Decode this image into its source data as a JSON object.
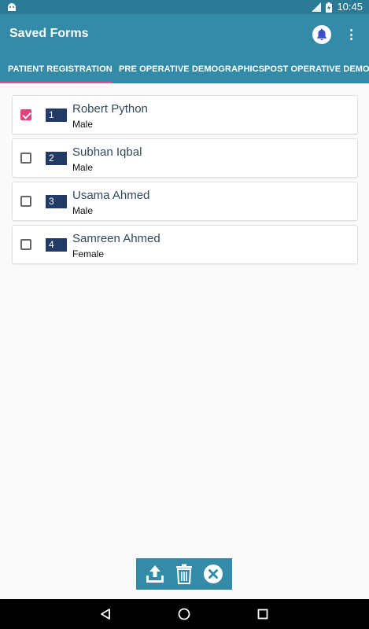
{
  "status_bar": {
    "time": "10:45",
    "icons": [
      "android-icon",
      "signal-icon",
      "battery-icon"
    ]
  },
  "app_bar": {
    "title": "Saved Forms",
    "icons": [
      "bell-icon",
      "more-vert-icon"
    ]
  },
  "tabs": [
    {
      "label": "PATIENT REGISTRATION",
      "selected": true
    },
    {
      "label": "PRE OPERATIVE DEMOGRAPHICS",
      "selected": false
    },
    {
      "label": "POST OPERATIVE DEMOGRAPHICS",
      "selected": false
    }
  ],
  "forms": [
    {
      "number": "1",
      "name": "Robert Python",
      "gender": "Male",
      "checked": true
    },
    {
      "number": "2",
      "name": "Subhan Iqbal",
      "gender": "Male",
      "checked": false
    },
    {
      "number": "3",
      "name": "Usama Ahmed",
      "gender": "Male",
      "checked": false
    },
    {
      "number": "4",
      "name": "Samreen Ahmed",
      "gender": "Female",
      "checked": false
    }
  ],
  "action_bar": {
    "icons": [
      "upload-icon",
      "delete-icon",
      "close-icon"
    ]
  },
  "nav_bar": {
    "icons": [
      "back-icon",
      "home-icon",
      "recents-icon"
    ]
  },
  "colors": {
    "primary": "#348ba8",
    "status_bar": "#2a7a96",
    "accent": "#e83e7c",
    "badge": "#213a66"
  }
}
